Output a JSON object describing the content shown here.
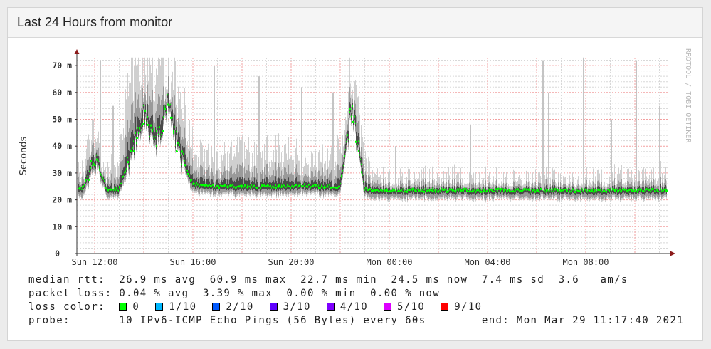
{
  "panel": {
    "title": "Last 24 Hours from monitor"
  },
  "graph": {
    "ylabel": "Seconds",
    "watermark": "RRDTOOL / TOBI OETIKER",
    "yticks": [
      "0",
      "10 m",
      "20 m",
      "30 m",
      "40 m",
      "50 m",
      "60 m",
      "70 m"
    ],
    "xticks": [
      "Sun 12:00",
      "Sun 16:00",
      "Sun 20:00",
      "Mon 00:00",
      "Mon 04:00",
      "Mon 08:00"
    ]
  },
  "legend": {
    "median_rtt": "median rtt:  26.9 ms avg  60.9 ms max  22.7 ms min  24.5 ms now  7.4 ms sd  3.6   am/s",
    "packet_loss": "packet loss: 0.04 % avg  3.39 % max  0.00 % min  0.00 % now",
    "loss_color_label": "loss color:",
    "loss_colors": [
      {
        "label": "0",
        "color": "#00ff00"
      },
      {
        "label": "1/10",
        "color": "#00b8ff"
      },
      {
        "label": "2/10",
        "color": "#0059ff"
      },
      {
        "label": "3/10",
        "color": "#5e00ff"
      },
      {
        "label": "4/10",
        "color": "#7e00ff"
      },
      {
        "label": "5/10",
        "color": "#dd00ff"
      },
      {
        "label": "9/10",
        "color": "#ff0000"
      }
    ],
    "probe": "probe:       10 IPv6-ICMP Echo Pings (56 Bytes) every 60s        end: Mon Mar 29 11:17:40 2021"
  },
  "chart_data": {
    "type": "area",
    "title": "Last 24 Hours from monitor",
    "ylabel": "Seconds",
    "ylim": [
      0,
      70
    ],
    "y_unit": "ms",
    "x_range_hours": 24,
    "first_sample": "Sun 11:30",
    "interval_min": 30,
    "median_ms": [
      24,
      36,
      24,
      24,
      38,
      52,
      42,
      56,
      36,
      26,
      25,
      25,
      25,
      25,
      25,
      25,
      25,
      25,
      25.5,
      25,
      25,
      25,
      55,
      24,
      23.5,
      23.5,
      23.5,
      23.5,
      23.5,
      23.5,
      23.5,
      23.5,
      23.5,
      23.5,
      23.5,
      23.5,
      23.5,
      23.5,
      23.5,
      23.5,
      23.5,
      23.5,
      23.5,
      23.5,
      23.5,
      23.5,
      23.5,
      23.5
    ],
    "smoke_max_ms": [
      32,
      50,
      31,
      40,
      74,
      74,
      74,
      74,
      62,
      45,
      38,
      36,
      40,
      42,
      38,
      40,
      42,
      40,
      38,
      36,
      38,
      42,
      74,
      36,
      30,
      29,
      30,
      28,
      30,
      29,
      31,
      29,
      28,
      30,
      29,
      30,
      28,
      29,
      30,
      29,
      28,
      30,
      29,
      30,
      31,
      29,
      30,
      32
    ],
    "spikes": [
      {
        "h": 0.93,
        "ms": 72
      },
      {
        "h": 1.45,
        "ms": 55
      },
      {
        "h": 5.57,
        "ms": 70
      },
      {
        "h": 7.4,
        "ms": 66
      },
      {
        "h": 9.13,
        "ms": 62
      },
      {
        "h": 10.4,
        "ms": 60
      },
      {
        "h": 12.96,
        "ms": 40
      },
      {
        "h": 16.0,
        "ms": 48
      },
      {
        "h": 18.96,
        "ms": 72
      },
      {
        "h": 19.2,
        "ms": 60
      },
      {
        "h": 20.6,
        "ms": 75
      },
      {
        "h": 21.74,
        "ms": 50
      },
      {
        "h": 22.75,
        "ms": 72
      },
      {
        "h": 23.7,
        "ms": 55
      }
    ],
    "median_color": "#00ff00",
    "grid": true
  }
}
